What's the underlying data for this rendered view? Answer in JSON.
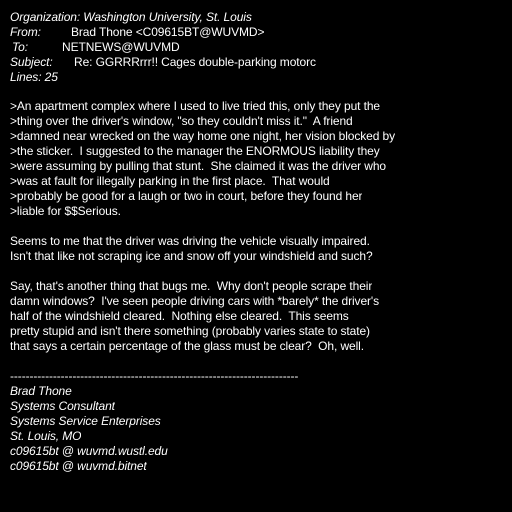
{
  "header": {
    "organization": "Organization: Washington University, St. Louis",
    "from_label": "From:",
    "from_value": "Brad Thone <C09615BT@WUVMD>",
    "to_label": "To:",
    "to_value": "NETNEWS@WUVMD",
    "subject_label": "Subject:",
    "subject_value": "Re: GGRRRrrr!! Cages double-parking motorc",
    "lines": "Lines: 25"
  },
  "quoted": [
    ">An apartment complex where I used to live tried this, only they put the",
    ">thing over the driver's window, \"so they couldn't miss it.\"  A friend",
    ">damned near wrecked on the way home one night, her vision blocked by",
    ">the sticker.  I suggested to the manager the ENORMOUS liability they",
    ">were assuming by pulling that stunt.  She claimed it was the driver who",
    ">was at fault for illegally parking in the first place.  That would",
    ">probably be good for a laugh or two in court, before they found her",
    ">liable for $$Serious."
  ],
  "paragraph1": [
    "Seems to me that the driver was driving the vehicle visually impaired.",
    "Isn't that like not scraping ice and snow off your windshield and such?"
  ],
  "paragraph2": [
    "Say, that's another thing that bugs me.  Why don't people scrape their",
    "damn windows?  I've seen people driving cars with *barely* the driver's",
    "half of the windshield cleared.  Nothing else cleared.  This seems",
    "pretty stupid and isn't there something (probably varies state to state)",
    "that says a certain percentage of the glass must be clear?  Oh, well."
  ],
  "signature": {
    "divider": "--------------------------------------------------------------------------",
    "lines": [
      "Brad Thone",
      "Systems Consultant",
      "Systems Service Enterprises",
      "St. Louis, MO",
      "c09615bt @ wuvmd.wustl.edu",
      "c09615bt @ wuvmd.bitnet"
    ]
  }
}
